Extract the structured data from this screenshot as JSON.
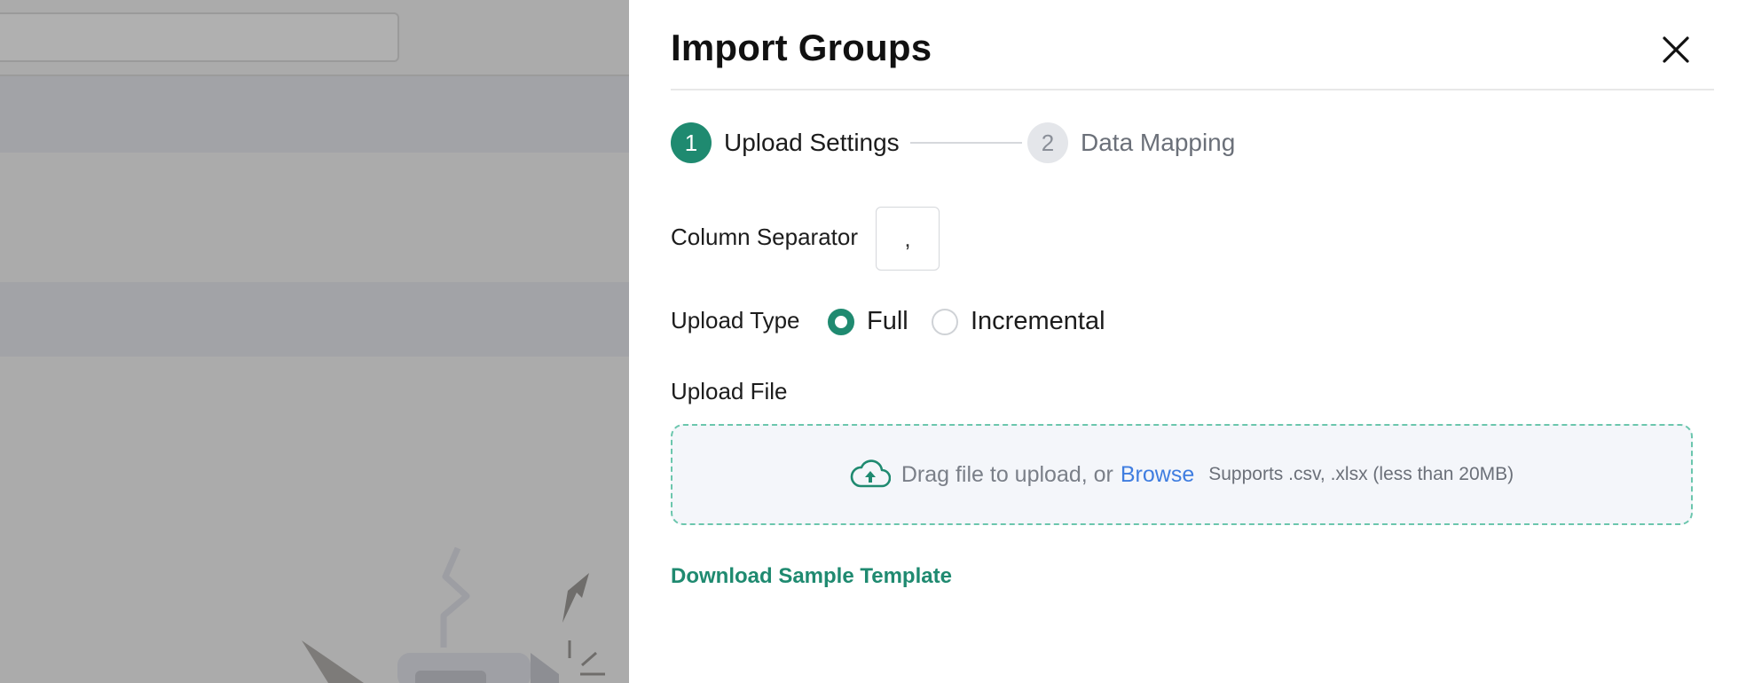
{
  "drawer": {
    "title": "Import Groups",
    "close_icon": "close-icon"
  },
  "stepper": {
    "steps": [
      {
        "number": "1",
        "label": "Upload Settings",
        "state": "active"
      },
      {
        "number": "2",
        "label": "Data Mapping",
        "state": "inactive"
      }
    ]
  },
  "form": {
    "column_separator": {
      "label": "Column Separator",
      "value": ","
    },
    "upload_type": {
      "label": "Upload Type",
      "options": [
        {
          "label": "Full",
          "selected": true
        },
        {
          "label": "Incremental",
          "selected": false
        }
      ]
    },
    "upload_file": {
      "label": "Upload File",
      "icon": "cloud-upload-icon",
      "drag_text": "Drag file to upload, or",
      "browse_label": "Browse",
      "hint": "Supports .csv, .xlsx  (less than 20MB)"
    },
    "download_template_label": "Download Sample Template"
  },
  "colors": {
    "accent": "#1f8a70",
    "link": "#3f7de0",
    "dropzone_border": "#6bc6ad",
    "backdrop": "#ababab"
  }
}
